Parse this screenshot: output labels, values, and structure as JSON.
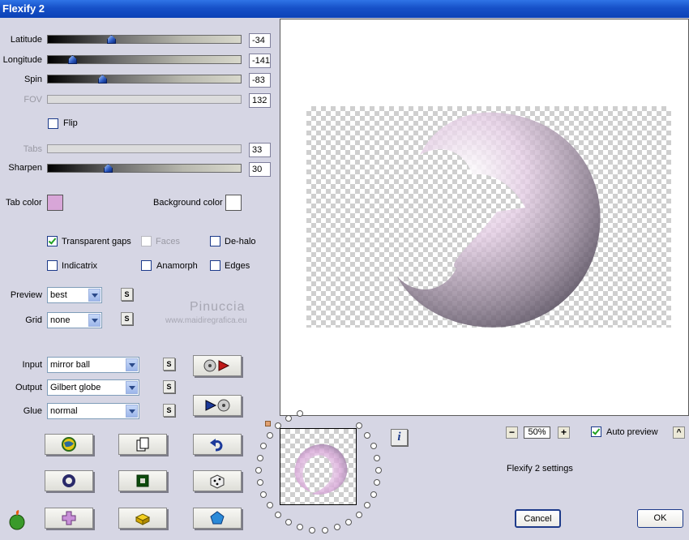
{
  "window": {
    "title": "Flexify 2"
  },
  "sliders": {
    "latitude": {
      "label": "Latitude",
      "value": "-34",
      "fraction": 0.32
    },
    "longitude": {
      "label": "Longitude",
      "value": "-141",
      "fraction": 0.11
    },
    "spin": {
      "label": "Spin",
      "value": "-83",
      "fraction": 0.27
    },
    "fov": {
      "label": "FOV",
      "value": "132"
    },
    "tabs": {
      "label": "Tabs",
      "value": "33"
    },
    "sharpen": {
      "label": "Sharpen",
      "value": "30",
      "fraction": 0.3
    }
  },
  "flip": {
    "label": "Flip",
    "checked": false
  },
  "colors": {
    "tab_color_label": "Tab color",
    "tab_color": "#d8a6d8",
    "background_color_label": "Background color",
    "background_color": "#ffffff"
  },
  "options": {
    "transparent_gaps": {
      "label": "Transparent gaps",
      "checked": true
    },
    "faces": {
      "label": "Faces",
      "checked": false
    },
    "de_halo": {
      "label": "De-halo",
      "checked": false
    },
    "indicatrix": {
      "label": "Indicatrix",
      "checked": false
    },
    "anamorph": {
      "label": "Anamorph",
      "checked": false
    },
    "edges": {
      "label": "Edges",
      "checked": false
    }
  },
  "preview": {
    "label": "Preview",
    "value": "best"
  },
  "grid": {
    "label": "Grid",
    "value": "none"
  },
  "input": {
    "label": "Input",
    "value": "mirror ball"
  },
  "output": {
    "label": "Output",
    "value": "Gilbert globe"
  },
  "glue": {
    "label": "Glue",
    "value": "normal"
  },
  "s_button_label": "S",
  "watermark": {
    "line1": "Pinuccia",
    "line2": "www.maidiregrafica.eu"
  },
  "zoom": {
    "minus": "−",
    "value": "50%",
    "plus": "+"
  },
  "auto_preview": {
    "label": "Auto preview",
    "checked": true
  },
  "caret_label": "^",
  "info_label": "i",
  "settings_name": "Flexify 2 settings",
  "buttons": {
    "cancel": "Cancel",
    "ok": "OK"
  },
  "accent": "#1650c8"
}
